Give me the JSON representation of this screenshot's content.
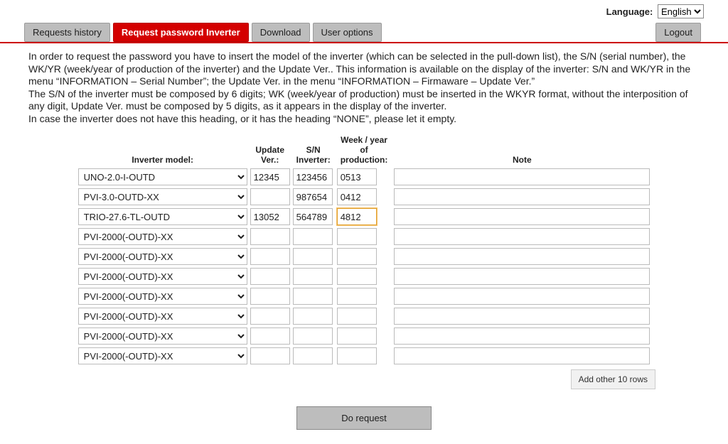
{
  "language": {
    "label": "Language:",
    "selected": "English",
    "options": [
      "English"
    ]
  },
  "tabs": {
    "history": "Requests history",
    "request": "Request password Inverter",
    "download": "Download",
    "options": "User options",
    "logout": "Logout"
  },
  "instructions": {
    "l1": "In order to request the password you have to insert the model of the inverter (which can be selected in the pull-down list), the S/N (serial number), the WK/YR (week/year of production of the inverter) and the Update Ver.. This information is available on the display of the inverter: S/N and WK/YR in the menu “INFORMATION – Serial Number”; the Update Ver. in the menu “INFORMATION – Firmaware – Update Ver.”",
    "l2": "The S/N of the inverter must be composed by 6 digits; WK (week/year of production) must be inserted in the WKYR format, without the interposition of any digit, Update Ver. must be composed by 5 digits, as it appears in the display of the inverter.",
    "l3": "In case the inverter does not have this heading, or it has the heading “NONE”, please let it empty."
  },
  "headers": {
    "model": "Inverter model:",
    "update": "Update Ver.:",
    "sn": "S/N Inverter:",
    "wkyr": "Week / year of production:",
    "note": "Note"
  },
  "default_model": "PVI-2000(-OUTD)-XX",
  "rows": [
    {
      "model": "UNO-2.0-I-OUTD",
      "upd": "12345",
      "sn": "123456",
      "wk": "0513",
      "note": ""
    },
    {
      "model": "PVI-3.0-OUTD-XX",
      "upd": "",
      "sn": "987654",
      "wk": "0412",
      "note": ""
    },
    {
      "model": "TRIO-27.6-TL-OUTD",
      "upd": "13052",
      "sn": "564789",
      "wk": "4812",
      "note": "",
      "focus": "wk"
    },
    {
      "model": "PVI-2000(-OUTD)-XX",
      "upd": "",
      "sn": "",
      "wk": "",
      "note": ""
    },
    {
      "model": "PVI-2000(-OUTD)-XX",
      "upd": "",
      "sn": "",
      "wk": "",
      "note": ""
    },
    {
      "model": "PVI-2000(-OUTD)-XX",
      "upd": "",
      "sn": "",
      "wk": "",
      "note": ""
    },
    {
      "model": "PVI-2000(-OUTD)-XX",
      "upd": "",
      "sn": "",
      "wk": "",
      "note": ""
    },
    {
      "model": "PVI-2000(-OUTD)-XX",
      "upd": "",
      "sn": "",
      "wk": "",
      "note": ""
    },
    {
      "model": "PVI-2000(-OUTD)-XX",
      "upd": "",
      "sn": "",
      "wk": "",
      "note": ""
    },
    {
      "model": "PVI-2000(-OUTD)-XX",
      "upd": "",
      "sn": "",
      "wk": "",
      "note": ""
    }
  ],
  "buttons": {
    "add_rows": "Add other 10 rows",
    "do_request": "Do request"
  }
}
